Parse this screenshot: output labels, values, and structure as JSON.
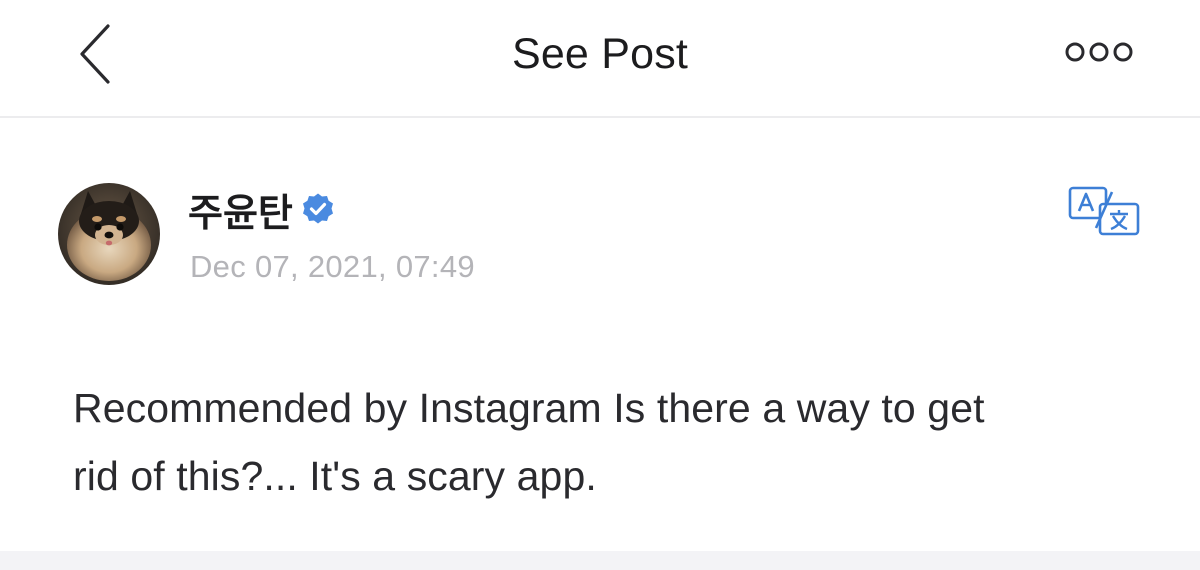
{
  "header": {
    "title": "See Post",
    "back_icon": "chevron-left-icon",
    "more_icon": "more-horizontal-icon"
  },
  "post": {
    "author": {
      "name": "주윤탄",
      "verified": true,
      "verified_icon": "verified-badge-icon",
      "avatar": "pomeranian-dog-avatar"
    },
    "date": "Dec 07, 2021, 07:49",
    "translate_icon": "translate-icon",
    "lines": [
      "Recommended by Instagram Is there a way to get",
      "rid of this?... It's a scary app."
    ]
  },
  "colors": {
    "accent": "#3d7fd6",
    "verified": "#4a8ae0",
    "text": "#2a2a2e",
    "muted": "#b4b4b8",
    "divider": "#ececee",
    "band": "#f3f3f6"
  }
}
